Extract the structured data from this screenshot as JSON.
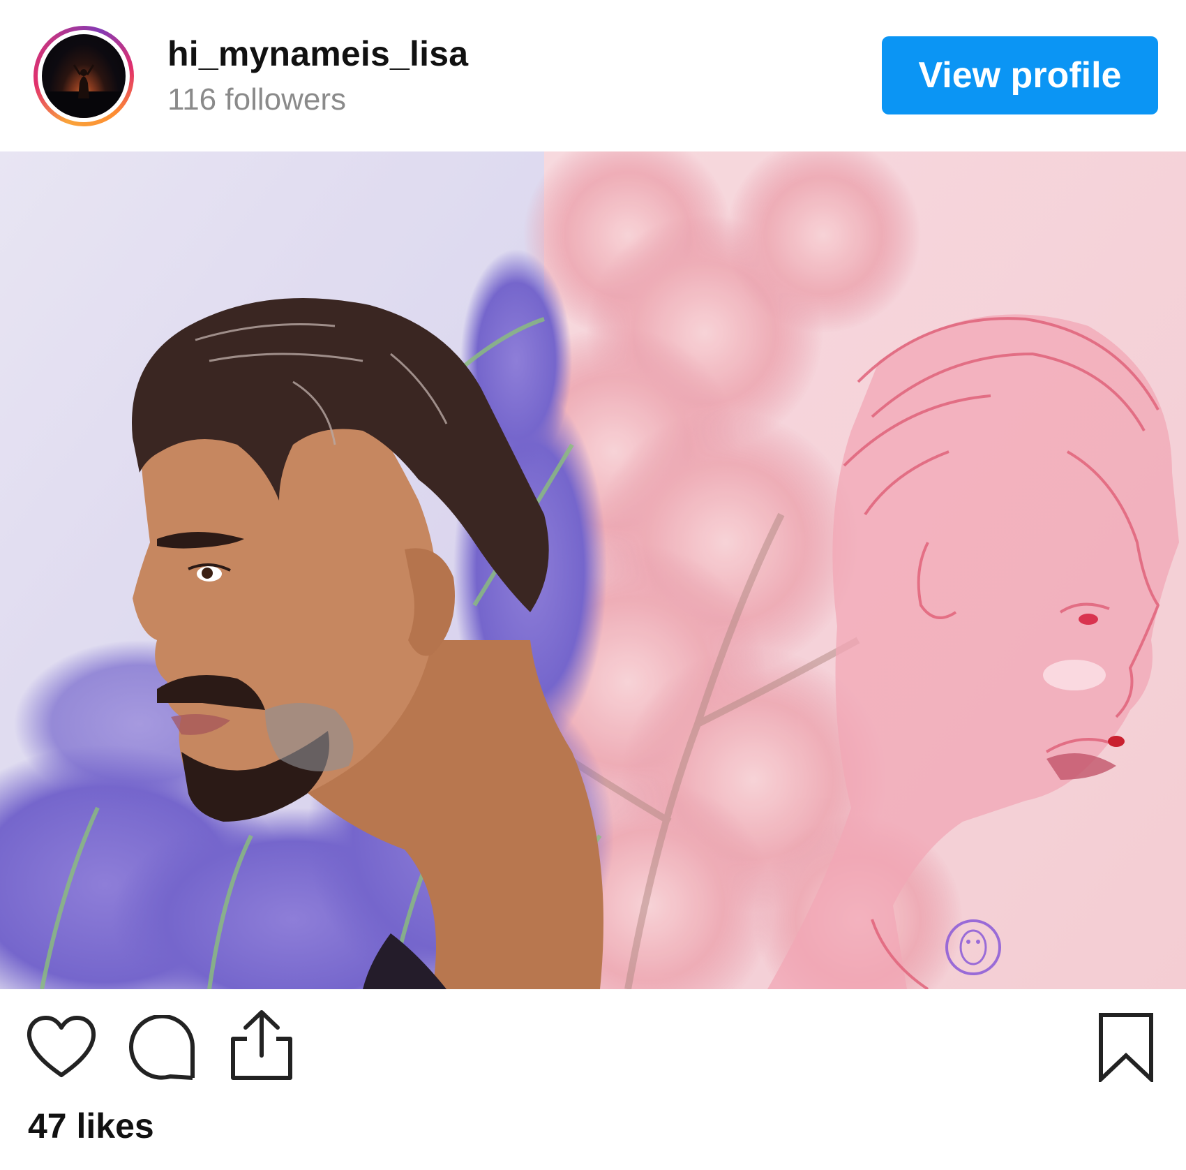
{
  "header": {
    "username": "hi_mynameis_lisa",
    "followers": "116 followers",
    "view_profile_label": "View profile"
  },
  "post": {
    "image_alt": "Illustrated portrait of a man in profile among lavender and pink cherry blossoms"
  },
  "actions": {
    "like_icon": "heart-icon",
    "comment_icon": "comment-icon",
    "share_icon": "share-icon",
    "save_icon": "bookmark-icon"
  },
  "likes": "47 likes",
  "colors": {
    "accent": "#0b95f4",
    "text": "#111111",
    "muted": "#8a8a8a"
  }
}
